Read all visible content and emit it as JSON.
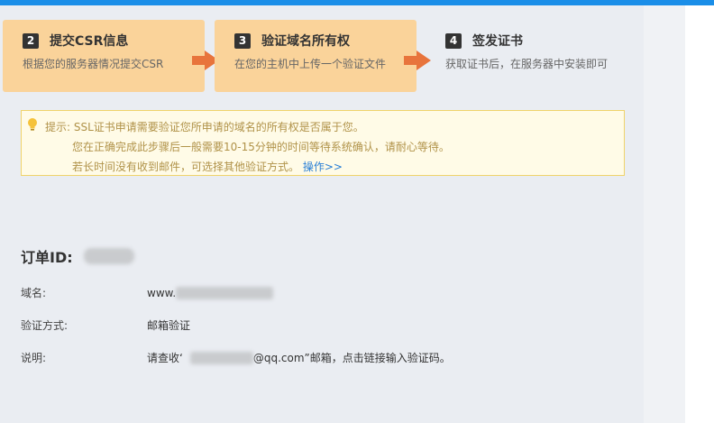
{
  "steps": [
    {
      "num": "2",
      "name": "提交CSR信息",
      "desc": "根据您的服务器情况提交CSR",
      "state": "done"
    },
    {
      "num": "3",
      "name": "验证域名所有权",
      "desc": "在您的主机中上传一个验证文件",
      "state": "done"
    },
    {
      "num": "4",
      "name": "签发证书",
      "desc": "获取证书后，在服务器中安装即可",
      "state": "current"
    }
  ],
  "tip": {
    "icon": "lightbulb-icon",
    "prefix": "提示:",
    "line1": "SSL证书申请需要验证您所申请的域名的所有权是否属于您。",
    "line2": "您在正确完成此步骤后一般需要10-15分钟的时间等待系统确认，请耐心等待。",
    "line3": "若长时间没有收到邮件，可选择其他验证方式。",
    "link": "操作>>"
  },
  "order": {
    "label": "订单ID:"
  },
  "details": {
    "domain_label": "域名:",
    "domain_prefix": "www.",
    "method_label": "验证方式:",
    "method_value": "邮箱验证",
    "note_label": "说明:",
    "note_before": "请查收‘",
    "note_email_suffix": "@qq.com",
    "note_after": "”邮箱，点击链接输入验证码。"
  },
  "colors": {
    "done_step": "#fad39a",
    "arrow": "#e8743c",
    "accent": "#1a8ee8",
    "tip_text": "#b09248",
    "link": "#2a7fd6"
  }
}
